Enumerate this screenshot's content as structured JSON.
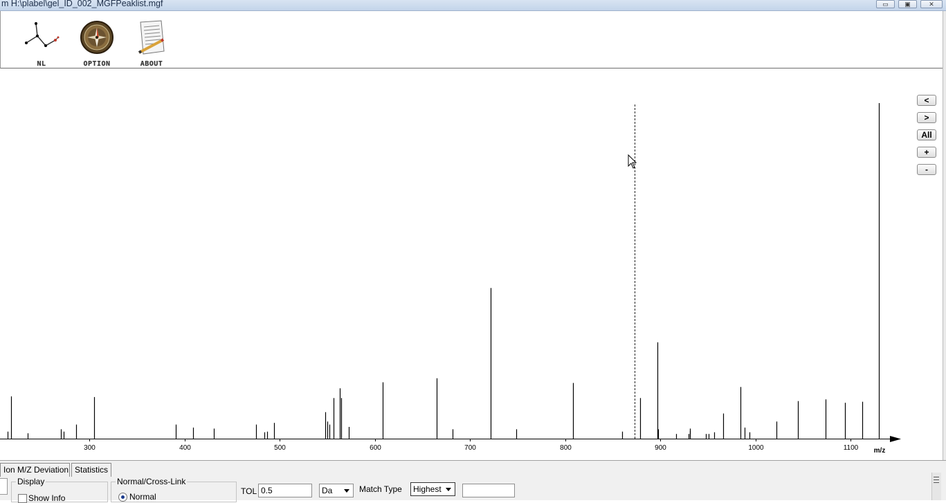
{
  "window": {
    "title": "m H:\\plabel\\gel_ID_002_MGFPeaklist.mgf",
    "min_label": "▭",
    "max_label": "▣",
    "close_label": "✕"
  },
  "toolbar": {
    "nl_label": "NL",
    "option_label": "OPTION",
    "about_label": "ABOUT"
  },
  "nav": {
    "prev_label": "<",
    "next_label": ">",
    "all_label": "All",
    "zoom_in_label": "+",
    "zoom_out_label": "-"
  },
  "chart_data": {
    "type": "bar",
    "xlabel": "m/z",
    "xlim": [
      190,
      1150
    ],
    "ylim": [
      0,
      100
    ],
    "xticks": [
      300,
      400,
      500,
      600,
      700,
      800,
      900,
      1000,
      1100
    ],
    "cursor_mz": 873,
    "peaks": [
      {
        "x": 192,
        "y": 21.7
      },
      {
        "x": 199,
        "y": 2.3
      },
      {
        "x": 201,
        "y": 2.3
      },
      {
        "x": 202,
        "y": 7.9
      },
      {
        "x": 214,
        "y": 2.1
      },
      {
        "x": 218,
        "y": 12.6
      },
      {
        "x": 235,
        "y": 1.6
      },
      {
        "x": 270,
        "y": 2.8
      },
      {
        "x": 273,
        "y": 2.1
      },
      {
        "x": 286,
        "y": 4.2
      },
      {
        "x": 305,
        "y": 12.4
      },
      {
        "x": 391,
        "y": 4.2
      },
      {
        "x": 409,
        "y": 3.3
      },
      {
        "x": 431,
        "y": 3.0
      },
      {
        "x": 475,
        "y": 4.2
      },
      {
        "x": 484,
        "y": 1.9
      },
      {
        "x": 487,
        "y": 2.1
      },
      {
        "x": 494,
        "y": 4.7
      },
      {
        "x": 548,
        "y": 7.9
      },
      {
        "x": 550,
        "y": 5.1
      },
      {
        "x": 552,
        "y": 4.2
      },
      {
        "x": 557,
        "y": 12.1
      },
      {
        "x": 563,
        "y": 15.0
      },
      {
        "x": 565,
        "y": 12.1
      },
      {
        "x": 573,
        "y": 3.5
      },
      {
        "x": 608,
        "y": 16.8
      },
      {
        "x": 665,
        "y": 18.0
      },
      {
        "x": 682,
        "y": 2.8
      },
      {
        "x": 722,
        "y": 44.9
      },
      {
        "x": 749,
        "y": 2.8
      },
      {
        "x": 808,
        "y": 16.6
      },
      {
        "x": 860,
        "y": 2.1
      },
      {
        "x": 879,
        "y": 12.1
      },
      {
        "x": 897,
        "y": 28.7
      },
      {
        "x": 898,
        "y": 2.8
      },
      {
        "x": 917,
        "y": 1.4
      },
      {
        "x": 930,
        "y": 1.4
      },
      {
        "x": 931,
        "y": 2.3
      },
      {
        "x": 931.5,
        "y": 3.0
      },
      {
        "x": 948,
        "y": 1.4
      },
      {
        "x": 951,
        "y": 1.4
      },
      {
        "x": 957,
        "y": 1.9
      },
      {
        "x": 966,
        "y": 7.5
      },
      {
        "x": 984,
        "y": 15.4
      },
      {
        "x": 989,
        "y": 3.3
      },
      {
        "x": 994,
        "y": 1.9
      },
      {
        "x": 1022,
        "y": 5.1
      },
      {
        "x": 1045,
        "y": 11.2
      },
      {
        "x": 1074,
        "y": 11.7
      },
      {
        "x": 1094,
        "y": 10.7
      },
      {
        "x": 1112,
        "y": 11.0
      },
      {
        "x": 1130,
        "y": 100
      }
    ]
  },
  "tabs": {
    "ion_mz_label": "Ion M/Z Deviation",
    "stats_label": "Statistics"
  },
  "controls": {
    "display_title": "Display",
    "show_info_label": "Show Info",
    "normal_cross_title": "Normal/Cross-Link",
    "normal_label": "Normal",
    "tol_label": "TOL",
    "tol_value": "0.5",
    "unit_value": "Da",
    "match_type_label": "Match Type",
    "match_type_value": "Highest",
    "extra_value": ""
  }
}
